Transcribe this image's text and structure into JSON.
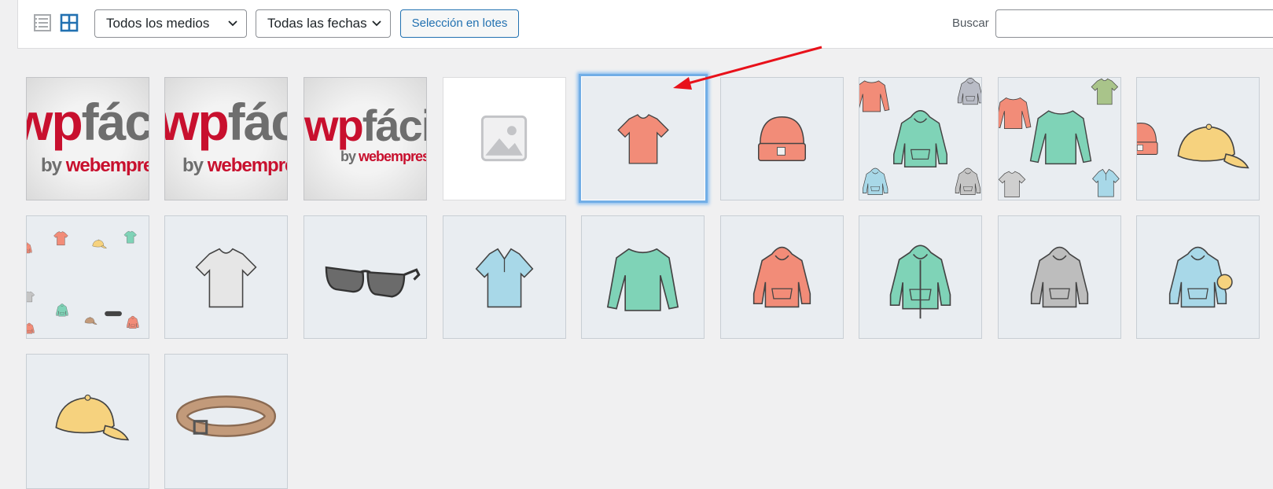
{
  "toolbar": {
    "media_filter": {
      "selected": "Todos los medios"
    },
    "date_filter": {
      "selected": "Todas las fechas"
    },
    "bulk_select_label": "Selección en lotes",
    "search_label": "Buscar",
    "search_value": ""
  },
  "logo": {
    "main_a": "wp",
    "main_b": "fácil",
    "sub_a": "by ",
    "sub_b": "webempresa"
  },
  "colors": {
    "accent": "#2271b1",
    "selection": "#72aee6",
    "arrow": "#e8111a",
    "logo_red": "#c8102e"
  },
  "media": [
    {
      "name": "wpfacil-logo-1",
      "icon": "logo-image"
    },
    {
      "name": "wpfacil-logo-2",
      "icon": "logo-image"
    },
    {
      "name": "wpfacil-logo-3",
      "icon": "logo-image"
    },
    {
      "name": "placeholder",
      "icon": "image-placeholder-icon"
    },
    {
      "name": "vneck-tshirt",
      "icon": "tshirt-icon",
      "selected": true
    },
    {
      "name": "beanie",
      "icon": "beanie-icon"
    },
    {
      "name": "hoodies-pattern",
      "icon": "hoodie-pattern"
    },
    {
      "name": "longsleeve-pattern",
      "icon": "longsleeve-pattern"
    },
    {
      "name": "beanie-cap",
      "icon": "cap-icon"
    },
    {
      "name": "clothing-pattern",
      "icon": "clothing-pattern"
    },
    {
      "name": "tshirt",
      "icon": "tshirt-icon"
    },
    {
      "name": "sunglasses",
      "icon": "sunglasses-icon"
    },
    {
      "name": "polo",
      "icon": "polo-icon"
    },
    {
      "name": "long-sleeve-tee",
      "icon": "longsleeve-icon"
    },
    {
      "name": "hoodie-red",
      "icon": "hoodie-icon"
    },
    {
      "name": "hoodie-zipper",
      "icon": "hoodie-icon"
    },
    {
      "name": "hoodie-grey",
      "icon": "hoodie-icon"
    },
    {
      "name": "hoodie-logo",
      "icon": "hoodie-icon"
    },
    {
      "name": "cap",
      "icon": "cap-icon"
    },
    {
      "name": "belt",
      "icon": "belt-icon"
    }
  ]
}
